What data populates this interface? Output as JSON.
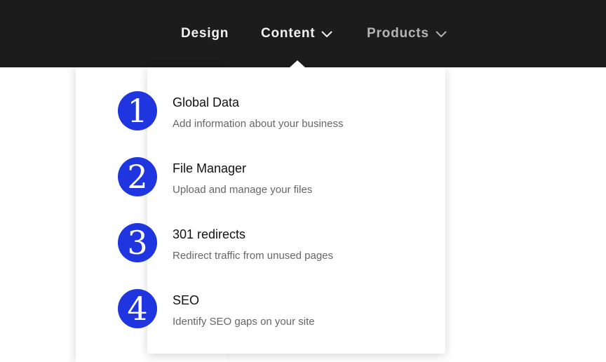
{
  "nav": {
    "items": [
      {
        "label": "Design",
        "has_dropdown": false,
        "active": false
      },
      {
        "label": "Content",
        "has_dropdown": true,
        "active": true
      },
      {
        "label": "Products",
        "has_dropdown": true,
        "active": false
      }
    ]
  },
  "colors": {
    "nav_background": "#1c1c1c",
    "badge": "#1f35df",
    "nav_text_active": "#f2f2f2",
    "nav_text_muted": "#b5b5b5"
  },
  "dropdown": {
    "items": [
      {
        "number": "1",
        "title": "Global Data",
        "description": "Add information about your business"
      },
      {
        "number": "2",
        "title": "File Manager",
        "description": "Upload and manage your files"
      },
      {
        "number": "3",
        "title": "301 redirects",
        "description": "Redirect traffic from unused pages"
      },
      {
        "number": "4",
        "title": "SEO",
        "description": "Identify SEO gaps on your site"
      }
    ]
  },
  "icons": {
    "dropdown_indicator": "chevron-down-icon"
  }
}
